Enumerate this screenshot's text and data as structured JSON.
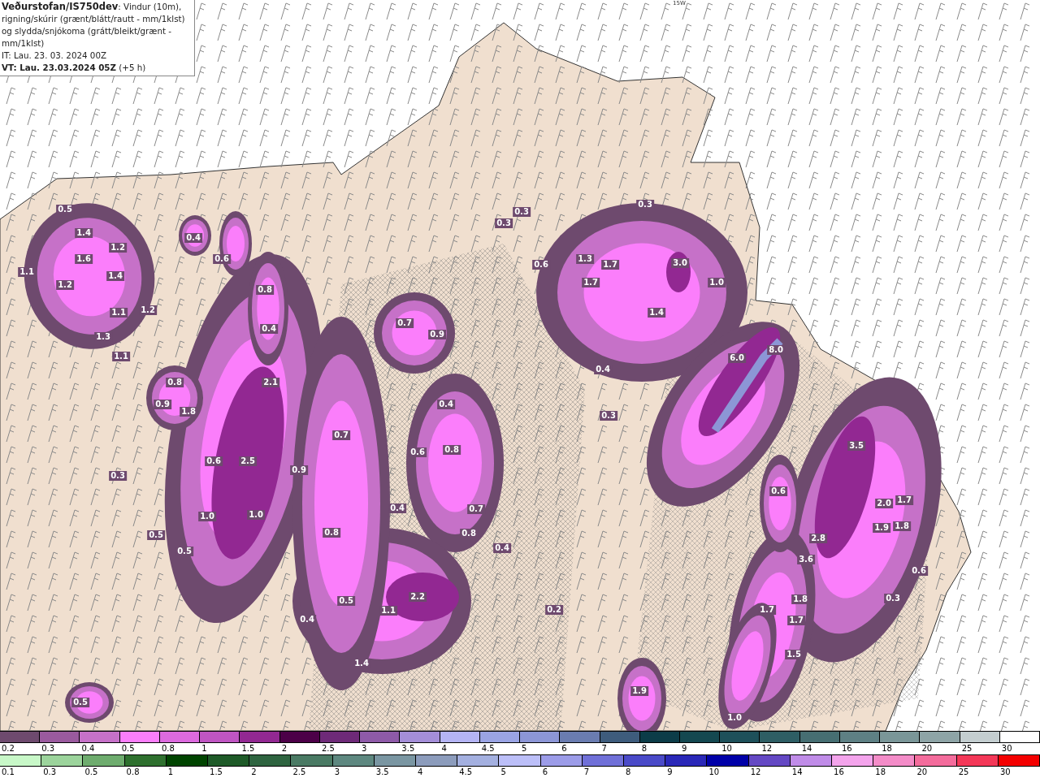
{
  "header": {
    "title": "**Veðurstofan/IS750dev**: Vindur (10m), rigning/skúrir (grænt/blátt/rautt - mm/1klst) og slydda/snjókoma (grátt/bleikt/grænt - mm/1klst)",
    "init_time": "IT: Lau. 23. 03. 2024 00Z",
    "valid_time": "**VT: Lau. 23.03.2024 05Z** (+5 h)"
  },
  "map": {
    "longitude_label": "15W",
    "value_labels": [
      "0.5",
      "1.4",
      "1.6",
      "1.2",
      "1.1",
      "1.4",
      "1.2",
      "1.1",
      "1.2",
      "1.3",
      "1.1",
      "0.4",
      "0.6",
      "0.8",
      "0.4",
      "2.1",
      "0.8",
      "0.9",
      "1.8",
      "0.3",
      "0.6",
      "2.5",
      "0.9",
      "1.0",
      "1.0",
      "0.5",
      "0.5",
      "0.7",
      "0.8",
      "0.4",
      "0.5",
      "1.1",
      "2.2",
      "1.4",
      "0.7",
      "0.9",
      "0.4",
      "0.6",
      "0.8",
      "0.4",
      "0.7",
      "0.8",
      "0.4",
      "0.3",
      "0.3",
      "0.3",
      "0.6",
      "1.3",
      "1.7",
      "1.7",
      "3.0",
      "1.0",
      "1.4",
      "0.4",
      "0.3",
      "6.0",
      "8.0",
      "0.6",
      "3.5",
      "2.0",
      "1.7",
      "1.9",
      "1.8",
      "2.8",
      "3.6",
      "0.6",
      "1.8",
      "0.3",
      "1.7",
      "1.7",
      "1.5",
      "0.5",
      "1.9",
      "1.0",
      "0.2"
    ]
  },
  "legends": [
    {
      "items": [
        {
          "label": "0.2",
          "color": "#6e4a6e"
        },
        {
          "label": "0.3",
          "color": "#9a5a9e"
        },
        {
          "label": "0.4",
          "color": "#c671c8"
        },
        {
          "label": "0.5",
          "color": "#fb7efb"
        },
        {
          "label": "0.8",
          "color": "#dc6ade"
        },
        {
          "label": "1",
          "color": "#bf55c2"
        },
        {
          "label": "1.5",
          "color": "#922892"
        },
        {
          "label": "2",
          "color": "#4c0048"
        },
        {
          "label": "2.5",
          "color": "#6e2a78"
        },
        {
          "label": "3",
          "color": "#8e5aa8"
        },
        {
          "label": "3.5",
          "color": "#a48ed8"
        },
        {
          "label": "4",
          "color": "#b4b4f4"
        },
        {
          "label": "4.5",
          "color": "#9aa4e4"
        },
        {
          "label": "5",
          "color": "#8c96d6"
        },
        {
          "label": "6",
          "color": "#6a7cb0"
        },
        {
          "label": "7",
          "color": "#3e5c7c"
        },
        {
          "label": "8",
          "color": "#0c3c48"
        },
        {
          "label": "9",
          "color": "#144850"
        },
        {
          "label": "10",
          "color": "#1e505a"
        },
        {
          "label": "12",
          "color": "#2e5e64"
        },
        {
          "label": "14",
          "color": "#466e72"
        },
        {
          "label": "16",
          "color": "#5e8084"
        },
        {
          "label": "18",
          "color": "#7a9698"
        },
        {
          "label": "20",
          "color": "#8ea4a6"
        },
        {
          "label": "25",
          "color": "#c4ced0"
        },
        {
          "label": "30",
          "color": "#ffffff"
        }
      ]
    },
    {
      "items": [
        {
          "label": "0.1",
          "color": "#c8f8c8"
        },
        {
          "label": "0.3",
          "color": "#9cd49c"
        },
        {
          "label": "0.5",
          "color": "#6eac6e"
        },
        {
          "label": "0.8",
          "color": "#2e702e"
        },
        {
          "label": "1",
          "color": "#004400"
        },
        {
          "label": "1.5",
          "color": "#1e5a28"
        },
        {
          "label": "2",
          "color": "#2e6440"
        },
        {
          "label": "2.5",
          "color": "#4a7a64"
        },
        {
          "label": "3",
          "color": "#5e8880"
        },
        {
          "label": "3.5",
          "color": "#7a96a2"
        },
        {
          "label": "4",
          "color": "#8c9cbc"
        },
        {
          "label": "4.5",
          "color": "#a4b0e0"
        },
        {
          "label": "5",
          "color": "#bcbff8"
        },
        {
          "label": "6",
          "color": "#9c9ce8"
        },
        {
          "label": "7",
          "color": "#7070d8"
        },
        {
          "label": "8",
          "color": "#4a4ac8"
        },
        {
          "label": "9",
          "color": "#2a28b8"
        },
        {
          "label": "10",
          "color": "#0000a8"
        },
        {
          "label": "12",
          "color": "#6448c4"
        },
        {
          "label": "14",
          "color": "#c08ce8"
        },
        {
          "label": "16",
          "color": "#f4a4ec"
        },
        {
          "label": "18",
          "color": "#f48cc8"
        },
        {
          "label": "20",
          "color": "#f46c9c"
        },
        {
          "label": "25",
          "color": "#f43858"
        },
        {
          "label": "30",
          "color": "#f40000"
        }
      ]
    }
  ]
}
